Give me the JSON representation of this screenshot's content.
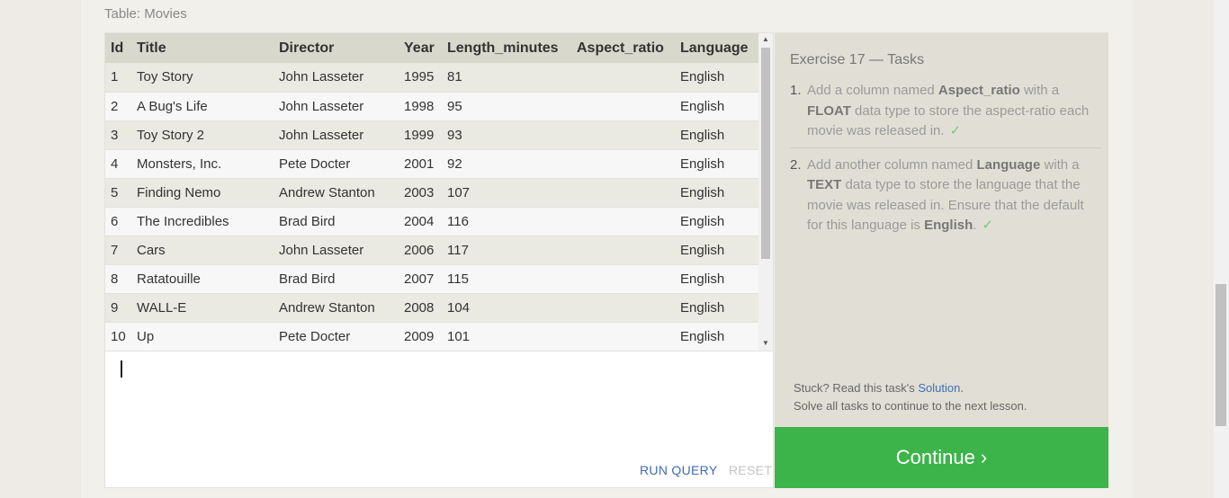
{
  "table_caption": "Table: Movies",
  "table": {
    "columns": [
      "Id",
      "Title",
      "Director",
      "Year",
      "Length_minutes",
      "Aspect_ratio",
      "Language"
    ],
    "rows": [
      [
        "1",
        "Toy Story",
        "John Lasseter",
        "1995",
        "81",
        "",
        "English"
      ],
      [
        "2",
        "A Bug's Life",
        "John Lasseter",
        "1998",
        "95",
        "",
        "English"
      ],
      [
        "3",
        "Toy Story 2",
        "John Lasseter",
        "1999",
        "93",
        "",
        "English"
      ],
      [
        "4",
        "Monsters, Inc.",
        "Pete Docter",
        "2001",
        "92",
        "",
        "English"
      ],
      [
        "5",
        "Finding Nemo",
        "Andrew Stanton",
        "2003",
        "107",
        "",
        "English"
      ],
      [
        "6",
        "The Incredibles",
        "Brad Bird",
        "2004",
        "116",
        "",
        "English"
      ],
      [
        "7",
        "Cars",
        "John Lasseter",
        "2006",
        "117",
        "",
        "English"
      ],
      [
        "8",
        "Ratatouille",
        "Brad Bird",
        "2007",
        "115",
        "",
        "English"
      ],
      [
        "9",
        "WALL-E",
        "Andrew Stanton",
        "2008",
        "104",
        "",
        "English"
      ],
      [
        "10",
        "Up",
        "Pete Docter",
        "2009",
        "101",
        "",
        "English"
      ]
    ]
  },
  "editor": {
    "run_label": "RUN QUERY",
    "reset_label": "RESET"
  },
  "tasks": {
    "title": "Exercise 17 — Tasks",
    "items": [
      {
        "num": "1.",
        "parts": [
          "Add a column named ",
          "Aspect_ratio",
          " with a ",
          "FLOAT",
          " data type to store the aspect-ratio each movie was released in."
        ],
        "check": "✓"
      },
      {
        "num": "2.",
        "parts": [
          "Add another column named ",
          "Language",
          " with a ",
          "TEXT",
          " data type to store the language that the movie was released in. Ensure that the default for this language is ",
          "English",
          "."
        ],
        "check": "✓"
      }
    ],
    "stuck_prefix": "Stuck? Read this task's ",
    "solution_link": "Solution",
    "stuck_suffix": ".",
    "solve_all": "Solve all tasks to continue to the next lesson."
  },
  "continue_label": "Continue ›",
  "colors": {
    "accent_green": "#3cb44a",
    "link_blue": "#3f6db5"
  }
}
